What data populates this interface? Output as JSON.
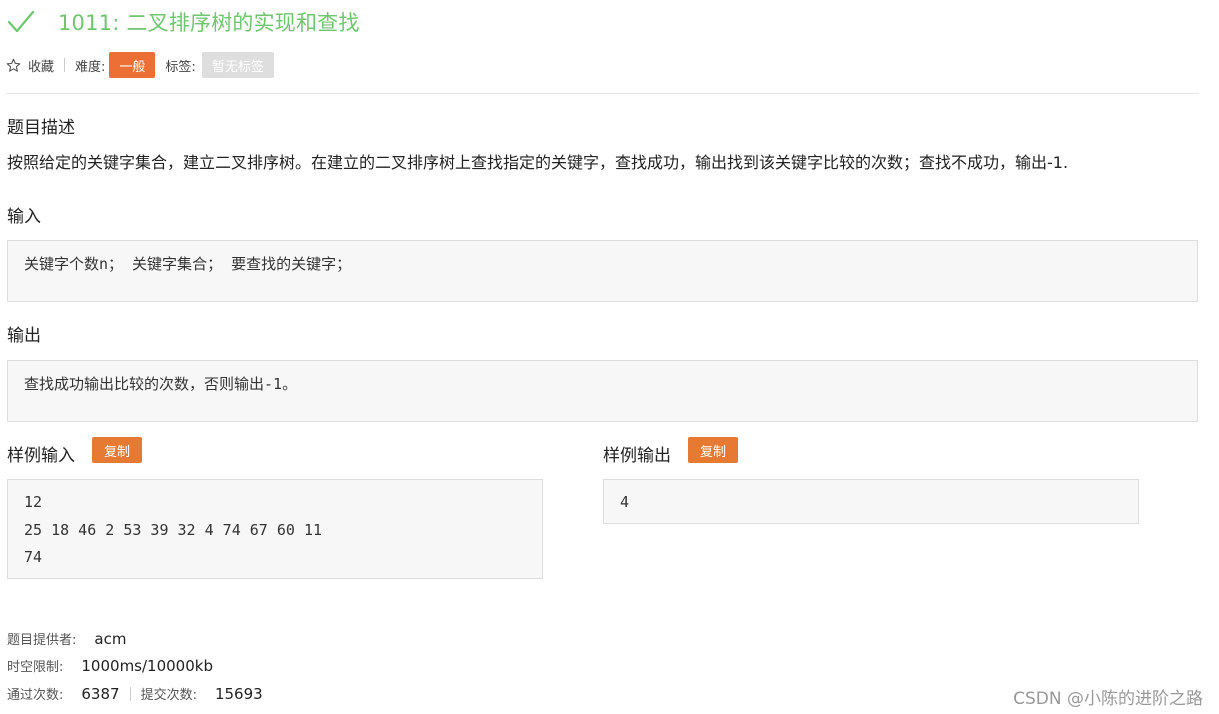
{
  "problem": {
    "title": "1011: 二叉排序树的实现和查找",
    "status_color": "#6fc66f"
  },
  "meta": {
    "favorite_label": "收藏",
    "difficulty_label": "难度:",
    "difficulty_value": "一般",
    "difficulty_color": "#ec6f36",
    "tags_label": "标签:",
    "tags_value": "暂无标签"
  },
  "description": {
    "heading": "题目描述",
    "text": "按照给定的关键字集合，建立二叉排序树。在建立的二叉排序树上查找指定的关键字，查找成功，输出找到该关键字比较的次数；查找不成功，输出-1."
  },
  "input_section": {
    "heading": "输入",
    "text": "关键字个数n； 关键字集合； 要查找的关键字；"
  },
  "output_section": {
    "heading": "输出",
    "text": "查找成功输出比较的次数，否则输出-1。"
  },
  "sample_input": {
    "heading": "样例输入",
    "copy_label": "复制",
    "lines": [
      "12",
      "25 18 46 2 53 39 32 4 74 67 60 11",
      "74"
    ]
  },
  "sample_output": {
    "heading": "样例输出",
    "copy_label": "复制",
    "lines": [
      "4"
    ]
  },
  "stats": {
    "provider_label": "题目提供者:",
    "provider_value": "acm",
    "limit_label": "时空限制:",
    "limit_value": "1000ms/10000kb",
    "accepted_label": "通过次数:",
    "accepted_value": "6387",
    "submitted_label": "提交次数:",
    "submitted_value": "15693"
  },
  "watermark": "CSDN @小陈的进阶之路"
}
